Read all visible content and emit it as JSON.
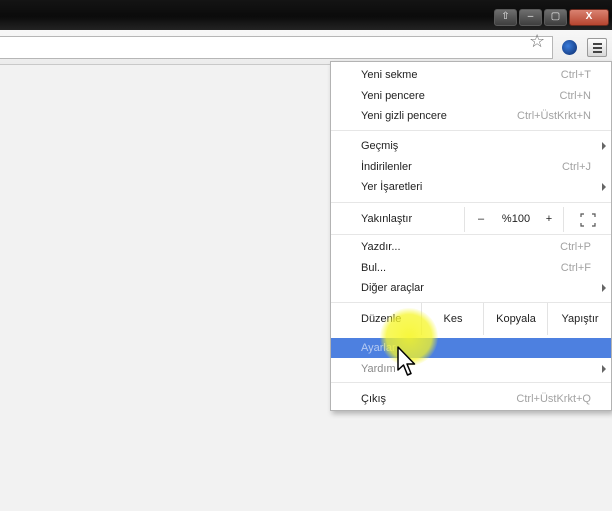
{
  "window": {
    "buttons": [
      "⇧",
      "–",
      "▢",
      "X"
    ]
  },
  "toolbar": {
    "bookmark_icon": "star-icon",
    "extension_icon": "globe-icon",
    "menu_icon": "hamburger-icon"
  },
  "menu": {
    "new_tab": {
      "label": "Yeni sekme",
      "shortcut": "Ctrl+T"
    },
    "new_window": {
      "label": "Yeni pencere",
      "shortcut": "Ctrl+N"
    },
    "incognito": {
      "label": "Yeni gizli pencere",
      "shortcut": "Ctrl+ÜstKrkt+N"
    },
    "history": {
      "label": "Geçmiş"
    },
    "downloads": {
      "label": "İndirilenler",
      "shortcut": "Ctrl+J"
    },
    "bookmarks": {
      "label": "Yer İşaretleri"
    },
    "zoom": {
      "label": "Yakınlaştır",
      "minus": "–",
      "value": "%100",
      "plus": "+",
      "fullscreen_icon": "fullscreen-icon"
    },
    "print": {
      "label": "Yazdır...",
      "shortcut": "Ctrl+P"
    },
    "find": {
      "label": "Bul...",
      "shortcut": "Ctrl+F"
    },
    "more_tools": {
      "label": "Diğer araçlar"
    },
    "edit": {
      "label": "Düzenle",
      "cut": "Kes",
      "copy": "Kopyala",
      "paste": "Yapıştır"
    },
    "settings": {
      "label": "Ayarlar"
    },
    "help": {
      "label": "Yardım"
    },
    "exit": {
      "label": "Çıkış",
      "shortcut": "Ctrl+ÜstKrkt+Q"
    }
  },
  "colors": {
    "highlight": "#4d80e0",
    "titlebar": "#141414",
    "cursor_glow": "#f6f628"
  }
}
